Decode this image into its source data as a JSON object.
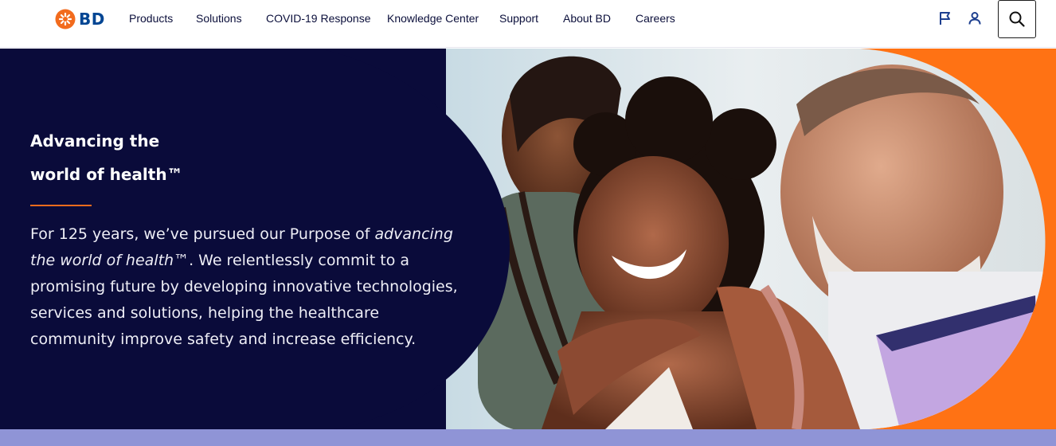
{
  "header": {
    "logo": {
      "text": "BD",
      "icon": "bd-starburst-logo-icon",
      "brand_color": "#004593",
      "icon_color": "#f26b1d"
    },
    "nav": [
      {
        "label": "Products"
      },
      {
        "label": "Solutions"
      },
      {
        "label": "COVID-19 Response"
      },
      {
        "label": "Knowledge Center"
      },
      {
        "label": "Support"
      },
      {
        "label": "About BD"
      },
      {
        "label": "Careers"
      }
    ],
    "utilities": [
      {
        "icon": "flag-icon"
      },
      {
        "icon": "user-icon"
      },
      {
        "icon": "search-icon"
      }
    ]
  },
  "hero": {
    "title_line1": "Advancing the",
    "title_line2": "world of health™",
    "copy_before": "For 125 years, we’ve pursued our Purpose of ",
    "copy_emphasis": "advancing the world of health™",
    "copy_after": ". We relentlessly commit to a promising future by developing innovative technologies, services and solutions, helping the healthcare community improve safety and increase efficiency.",
    "panel_color": "#0a0b3a",
    "accent_color": "#ff7214",
    "rule_color": "#f26b1d"
  },
  "band": {
    "color": "#8f94d6"
  }
}
